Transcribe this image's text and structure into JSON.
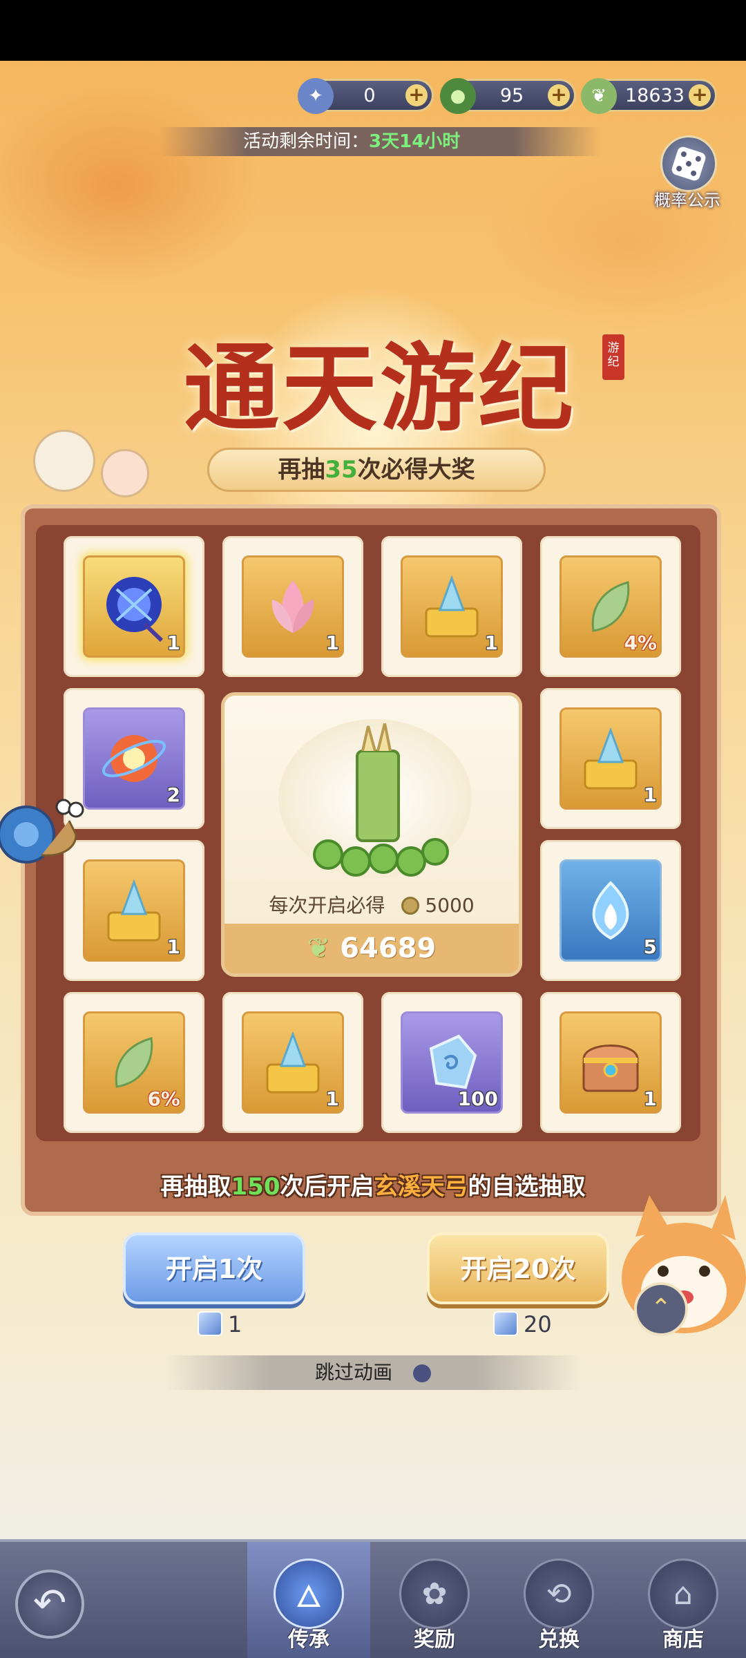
{
  "currencies": [
    {
      "icon": "ticket-icon",
      "value": "0"
    },
    {
      "icon": "jade-icon",
      "value": "95"
    },
    {
      "icon": "leaf-icon",
      "value": "18633"
    }
  ],
  "timer": {
    "label": "活动剩余时间：",
    "value": "3天14小时"
  },
  "probability_label": "概率公示",
  "title": "通天游纪",
  "seal_text": "游纪",
  "pity_banner": {
    "prefix": "再抽",
    "count": "35",
    "suffix": "次必得大奖"
  },
  "grid_items": [
    {
      "icon": "blue-umbrella-icon",
      "qty": "1",
      "style": "gold-hl"
    },
    {
      "icon": "pink-petal-icon",
      "qty": "1",
      "style": ""
    },
    {
      "icon": "crystal-chest-icon",
      "qty": "1",
      "style": ""
    },
    {
      "icon": "green-leaf-icon",
      "qty": "4%",
      "style": "pct"
    },
    {
      "icon": "orb-icon",
      "qty": "2",
      "style": "purple"
    },
    {
      "icon": "crystal-chest-icon",
      "qty": "1",
      "style": ""
    },
    {
      "icon": "crystal-chest-icon",
      "qty": "1",
      "style": ""
    },
    {
      "icon": "blue-flame-icon",
      "qty": "5",
      "style": "blue"
    },
    {
      "icon": "green-leaf-icon",
      "qty": "6%",
      "style": "pct"
    },
    {
      "icon": "crystal-chest-icon",
      "qty": "1",
      "style": ""
    },
    {
      "icon": "blue-gem-icon",
      "qty": "100",
      "style": "purple"
    },
    {
      "icon": "treasure-chest-icon",
      "qty": "1",
      "style": ""
    }
  ],
  "center": {
    "label": "每次开启必得",
    "coin_amount": "5000",
    "total": "64689"
  },
  "unlock_text": {
    "prefix": "再抽取",
    "count": "150",
    "middle": "次后开启",
    "item": "玄溪天弓",
    "suffix": "的自选抽取"
  },
  "buttons": {
    "draw_one": {
      "label": "开启1次",
      "cost": "1"
    },
    "draw_twenty": {
      "label": "开启20次",
      "cost": "20"
    }
  },
  "skip_label": "跳过动画",
  "nav": {
    "tabs": [
      {
        "label": "传承",
        "icon": "flame-icon",
        "active": true
      },
      {
        "label": "奖励",
        "icon": "gift-icon",
        "active": false
      },
      {
        "label": "兑换",
        "icon": "exchange-icon",
        "active": false
      },
      {
        "label": "商店",
        "icon": "shop-icon",
        "active": false
      }
    ]
  },
  "colors": {
    "accent_green": "#43b03c",
    "title_red": "#b5301c",
    "highlight_orange": "#ffb03c"
  }
}
